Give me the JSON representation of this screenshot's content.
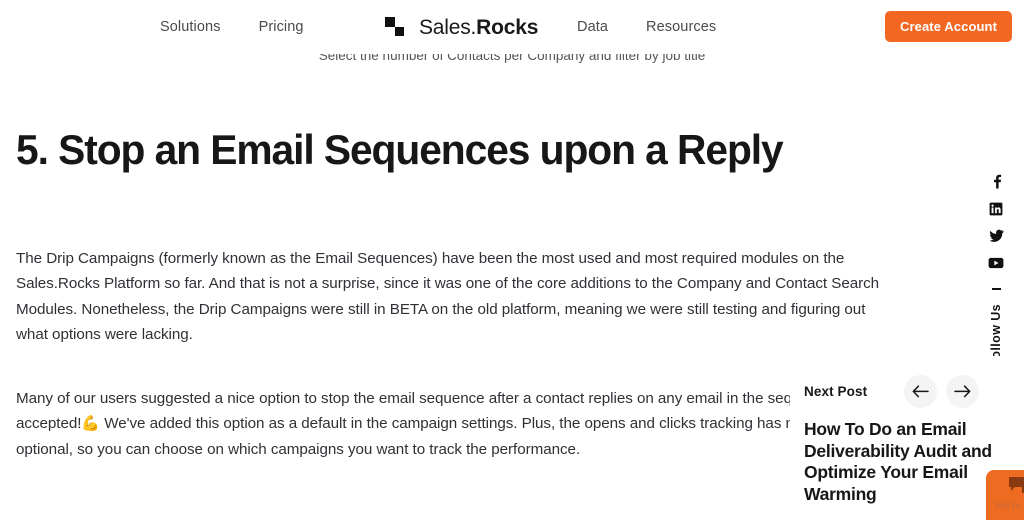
{
  "header": {
    "nav_left": [
      {
        "label": "Solutions"
      },
      {
        "label": "Pricing"
      }
    ],
    "nav_right": [
      {
        "label": "Data"
      },
      {
        "label": "Resources"
      }
    ],
    "logo": {
      "name_light": "Sales.",
      "name_bold": "Rocks",
      "icon": "sales-rocks-logo-icon"
    },
    "cta_label": "Create Account",
    "cta_color": "#F26722"
  },
  "cut_caption": {
    "text": "Select the number of Contacts per Company and filter by job title"
  },
  "article": {
    "title": "5. Stop an Email Sequences upon a Reply",
    "paragraph_1": "The Drip Campaigns (formerly known as the Email Sequences) have been the most used and most required modules on the Sales.Rocks Platform so far. And that is not a surprise, since it was one of the core additions to the Company and Contact Search Modules. Nonetheless, the Drip Campaigns were still in BETA on the old platform, meaning we were still testing and figuring out what options were lacking.",
    "paragraph_2_before": "Many of our users suggested a nice option to stop the email sequence after a contact replies on any email in the sequence. Challenge accepted!",
    "paragraph_2_emoji": "💪",
    "paragraph_2_after": " We've added this option as a default in the campaign settings. Plus, the opens and clicks tracking has now been made optional, so you can choose on which campaigns you want to track the performance."
  },
  "social_rail": {
    "items": [
      {
        "icon": "facebook-icon",
        "label": "Facebook"
      },
      {
        "icon": "linkedin-icon",
        "label": "LinkedIn"
      },
      {
        "icon": "twitter-icon",
        "label": "Twitter"
      },
      {
        "icon": "youtube-icon",
        "label": "YouTube"
      }
    ],
    "vertical_text": "Follow Us"
  },
  "next_post": {
    "label": "Next Post",
    "prev_icon": "arrow-left-icon",
    "next_icon": "arrow-right-icon",
    "title": "How To Do an Email Deliverability Audit and Optimize Your Email Warming"
  },
  "chat_widget": {
    "icon": "chat-bubble-icon",
    "status_text": "We're offline.",
    "color": "#EE6C21"
  }
}
